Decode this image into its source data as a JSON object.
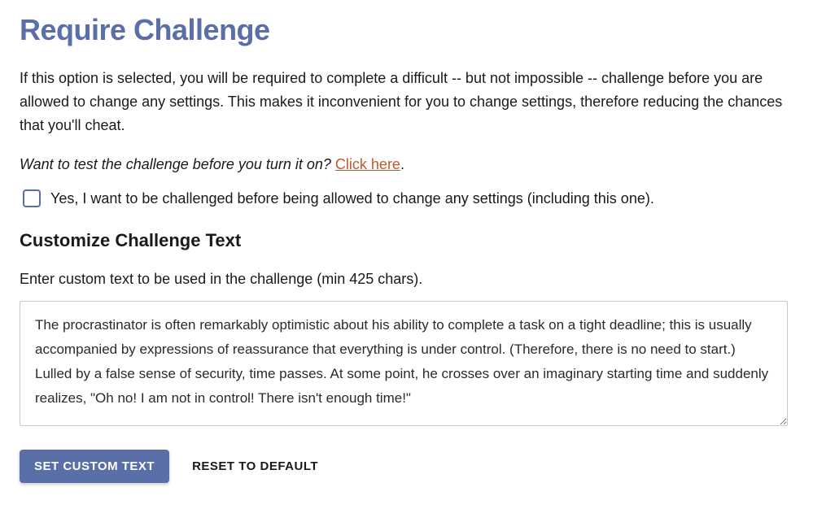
{
  "title": "Require Challenge",
  "description": "If this option is selected, you will be required to complete a difficult -- but not impossible -- challenge before you are allowed to change any settings. This makes it inconvenient for you to change settings, therefore reducing the chances that you'll cheat.",
  "test_prompt": "Want to test the challenge before you turn it on? ",
  "test_link": "Click here",
  "test_period": ".",
  "checkbox_label": "Yes, I want to be challenged before being allowed to change any settings (including this one).",
  "customize_heading": "Customize Challenge Text",
  "customize_instruction": "Enter custom text to be used in the challenge (min 425 chars).",
  "textarea_value": "The procrastinator is often remarkably optimistic about his ability to complete a task on a tight deadline; this is usually accompanied by expressions of reassurance that everything is under control. (Therefore, there is no need to start.) Lulled by a false sense of security, time passes. At some point, he crosses over an imaginary starting time and suddenly realizes, \"Oh no! I am not in control! There isn't enough time!\"",
  "set_button": "SET CUSTOM TEXT",
  "reset_button": "RESET TO DEFAULT"
}
